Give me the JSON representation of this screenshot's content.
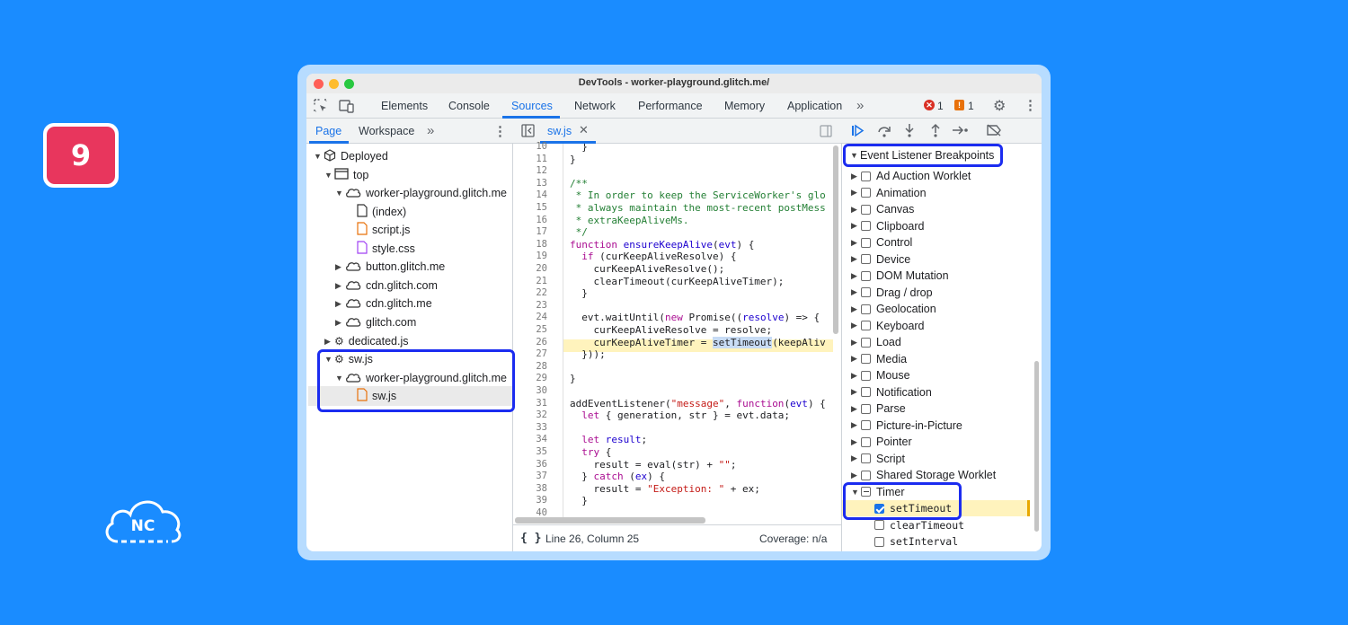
{
  "badge": {
    "number": "9"
  },
  "logo": {
    "text": "NC"
  },
  "window": {
    "title": "DevTools - worker-playground.glitch.me/"
  },
  "main_tabs": [
    {
      "label": "Elements",
      "active": false
    },
    {
      "label": "Console",
      "active": false
    },
    {
      "label": "Sources",
      "active": true
    },
    {
      "label": "Network",
      "active": false
    },
    {
      "label": "Performance",
      "active": false
    },
    {
      "label": "Memory",
      "active": false
    },
    {
      "label": "Application",
      "active": false
    }
  ],
  "counters": {
    "errors": "1",
    "warnings": "1"
  },
  "navigator": {
    "tabs": [
      "Page",
      "Workspace"
    ],
    "tree": [
      {
        "label": "Deployed"
      },
      {
        "label": "top"
      },
      {
        "label": "worker-playground.glitch.me"
      },
      {
        "label": "(index)"
      },
      {
        "label": "script.js"
      },
      {
        "label": "style.css"
      },
      {
        "label": "button.glitch.me"
      },
      {
        "label": "cdn.glitch.com"
      },
      {
        "label": "cdn.glitch.me"
      },
      {
        "label": "glitch.com"
      },
      {
        "label": "dedicated.js"
      },
      {
        "label": "sw.js"
      },
      {
        "label": "worker-playground.glitch.me"
      },
      {
        "label": "sw.js"
      }
    ]
  },
  "editor": {
    "file_tab": "sw.js",
    "line_numbers": [
      "10",
      "11",
      "12",
      "13",
      "14",
      "15",
      "16",
      "17",
      "18",
      "19",
      "20",
      "21",
      "22",
      "23",
      "24",
      "25",
      "26",
      "27",
      "28",
      "29",
      "30",
      "31",
      "32",
      "33",
      "34",
      "35",
      "36",
      "37",
      "38",
      "39",
      "40"
    ],
    "status": {
      "format_icon": "{ }",
      "position": "Line 26, Column 25",
      "coverage": "Coverage: n/a"
    }
  },
  "breakpoints": {
    "section_title": "Event Listener Breakpoints",
    "categories": [
      {
        "label": "Ad Auction Worklet"
      },
      {
        "label": "Animation"
      },
      {
        "label": "Canvas"
      },
      {
        "label": "Clipboard"
      },
      {
        "label": "Control"
      },
      {
        "label": "Device"
      },
      {
        "label": "DOM Mutation"
      },
      {
        "label": "Drag / drop"
      },
      {
        "label": "Geolocation"
      },
      {
        "label": "Keyboard"
      },
      {
        "label": "Load"
      },
      {
        "label": "Media"
      },
      {
        "label": "Mouse"
      },
      {
        "label": "Notification"
      },
      {
        "label": "Parse"
      },
      {
        "label": "Picture-in-Picture"
      },
      {
        "label": "Pointer"
      },
      {
        "label": "Script"
      },
      {
        "label": "Shared Storage Worklet"
      }
    ],
    "timer": {
      "label": "Timer",
      "items": [
        {
          "label": "setTimeout",
          "checked": true
        },
        {
          "label": "clearTimeout",
          "checked": false
        },
        {
          "label": "setInterval",
          "checked": false
        }
      ]
    }
  },
  "colors": {
    "background": "#1a8cff",
    "accent": "#1a73e8",
    "highlight_outline": "#1b2cf0",
    "badge": "#e8365d"
  }
}
